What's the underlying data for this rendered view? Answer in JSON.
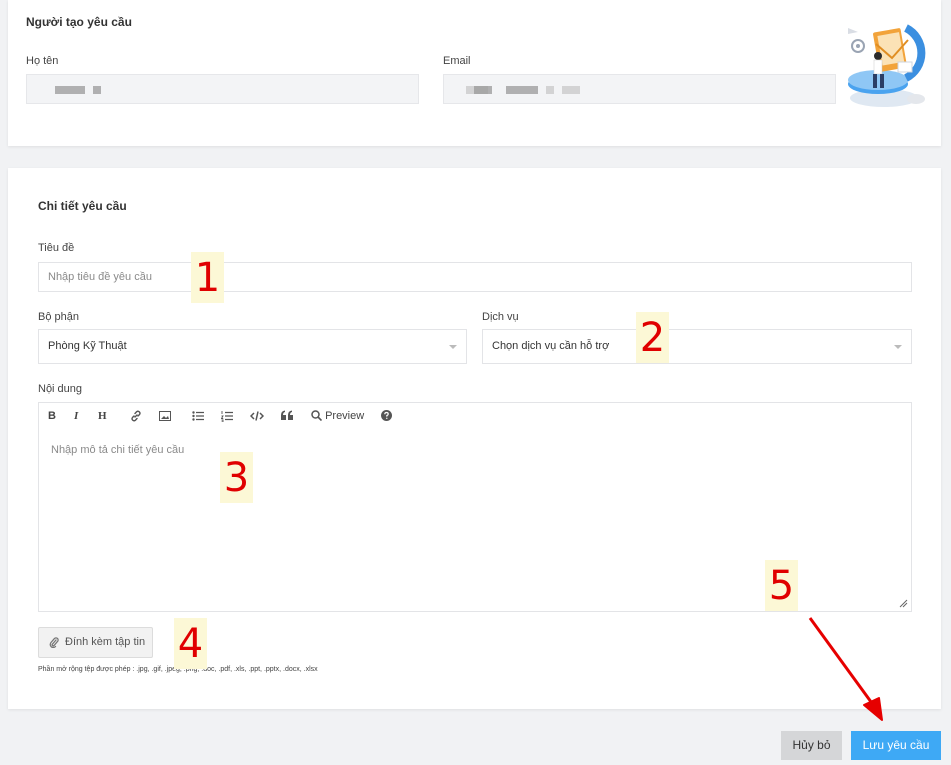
{
  "creator": {
    "title": "Người tạo yêu cầu",
    "name_label": "Họ tên",
    "email_label": "Email"
  },
  "detail": {
    "title": "Chi tiết yêu cầu",
    "subject_label": "Tiêu đề",
    "subject_placeholder": "Nhập tiêu đề yêu cầu",
    "department_label": "Bộ phận",
    "department_value": "Phòng Kỹ Thuật",
    "service_label": "Dịch vụ",
    "service_value": "Chọn dịch vụ cần hỗ trợ",
    "content_label": "Nội dung",
    "content_placeholder": "Nhập mô tả chi tiết yêu cầu",
    "toolbar": {
      "bold": "B",
      "italic": "I",
      "heading": "H",
      "preview": "Preview"
    },
    "attach_label": "Đính kèm tập tin",
    "extensions_note": "Phần mở rộng tệp được phép : .jpg, .gif, .jpeg, .png, .doc, .pdf, .xls, .ppt, .pptx, .docx, .xlsx"
  },
  "actions": {
    "cancel_label": "Hủy bỏ",
    "save_label": "Lưu yêu cầu"
  },
  "annotations": [
    "1",
    "2",
    "3",
    "4",
    "5"
  ],
  "colors": {
    "primary": "#3ea9f5",
    "annotation_text": "#e00000",
    "annotation_bg": "#fcf8d6",
    "arrow": "#e60000"
  },
  "icons": [
    "link-icon",
    "image-icon",
    "unordered-list-icon",
    "ordered-list-icon",
    "code-icon",
    "quote-icon",
    "search-icon",
    "help-icon",
    "paperclip-icon"
  ]
}
